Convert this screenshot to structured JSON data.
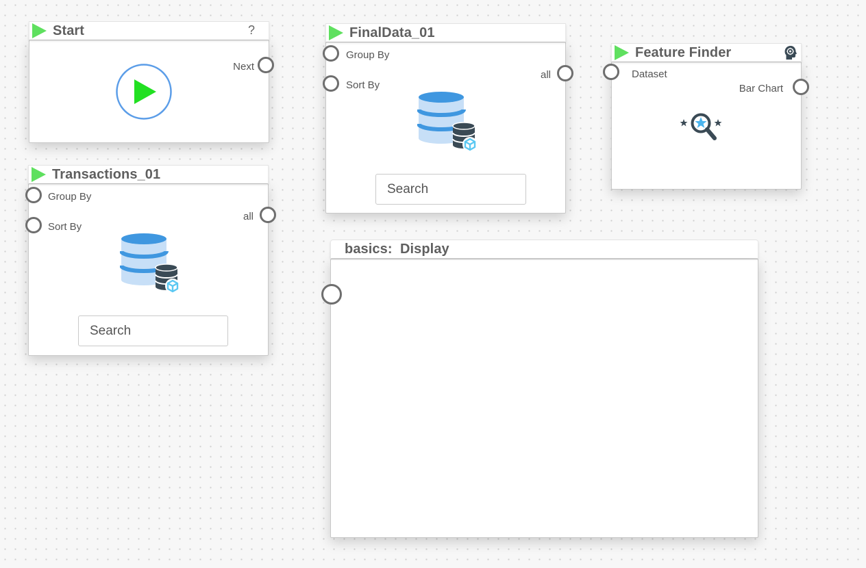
{
  "nodes": {
    "start": {
      "title": "Start",
      "help": "?",
      "ports": {
        "next": "Next"
      }
    },
    "transactions": {
      "title": "Transactions_01",
      "ports": {
        "group_by": "Group By",
        "sort_by": "Sort By",
        "all": "all"
      },
      "search_placeholder": "Search"
    },
    "finaldata": {
      "title": "FinalData_01",
      "ports": {
        "group_by": "Group By",
        "sort_by": "Sort By",
        "all": "all"
      },
      "search_placeholder": "Search"
    },
    "feature_finder": {
      "title": "Feature Finder",
      "ports": {
        "dataset": "Dataset",
        "bar_chart": "Bar Chart"
      }
    },
    "display": {
      "title": "basics:  Display"
    }
  },
  "icons": {
    "run": "play-triangle-icon",
    "start_play": "play-circle-icon",
    "database": "database-icon",
    "feature_finder": "magnifier-star-icon",
    "brain": "brain-head-icon"
  },
  "colors": {
    "run_green": "#5fe05f",
    "play_green": "#22e022",
    "play_ring": "#5b9de8",
    "db_blue": "#3f97e0",
    "db_light": "#c7dff7",
    "db_dark": "#3a4a55",
    "cube_cyan": "#5bc8f2"
  }
}
